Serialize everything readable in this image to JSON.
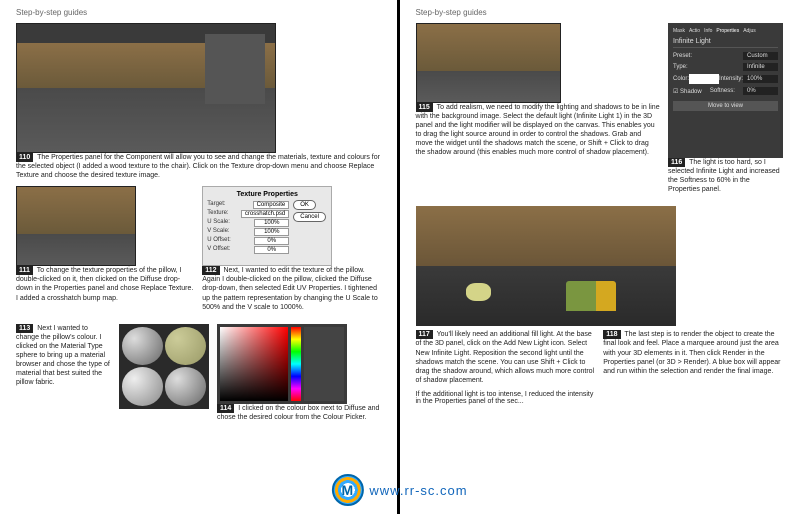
{
  "header": "Step-by-step guides",
  "steps": {
    "s10": {
      "num": "110",
      "text": "The Properties panel for the Component will allow you to see and change the materials, texture and colours for the selected object (I added a wood texture to the chair). Click on the Texture drop-down menu and choose Replace Texture and choose the desired texture image."
    },
    "s11": {
      "num": "111",
      "text": "To change the texture properties of the pillow, I double-clicked on it, then clicked on the Diffuse drop-down in the Properties panel and chose Replace Texture. I added a crosshatch bump map."
    },
    "s12": {
      "num": "112",
      "text": "Next, I wanted to edit the texture of the pillow. Again I double-clicked on the pillow, clicked the Diffuse drop-down, then selected Edit UV Properties. I tightened up the pattern representation by changing the U Scale to 500% and the V scale to 1000%."
    },
    "s13": {
      "num": "113",
      "text": "Next I wanted to change the pillow's colour. I clicked on the Material Type sphere to bring up a material browser and chose the type of material that best suited the pillow fabric."
    },
    "s14": {
      "num": "114",
      "text": "I clicked on the colour box next to Diffuse and chose the desired colour from the Colour Picker."
    },
    "s15": {
      "num": "115",
      "text": "To add realism, we need to modify the lighting and shadows to be in line with the background image. Select the default light (Infinite Light 1) in the 3D panel and the light modifier will be displayed on the canvas. This enables you to drag the light source around in order to control the shadows. Grab and move the widget until the shadows match the scene, or Shift + Click to drag the shadow around (this enables much more control of shadow placement)."
    },
    "s16": {
      "num": "116",
      "text": "The light is too hard, so I selected Infinite Light and increased the Softness to 60% in the Properties panel."
    },
    "s17": {
      "num": "117",
      "text": "You'll likely need an additional fill light. At the base of the 3D panel, click on the Add New Light icon. Select New Infinite Light. Reposition the second light until the shadows match the scene. You can use Shift + Click to drag the shadow around, which allows much more control of shadow placement."
    },
    "s18": {
      "num": "118",
      "text": "The last step is to render the object to create the final look and feel. Place a marquee around just the area with your 3D elements in it. Then click Render in the Properties panel (or 3D > Render). A blue box will appear and run within the selection and render the final image."
    },
    "cutL": "If the additional light is too intense, I reduced the intensity in the Properties panel of the sec..."
  },
  "texPanel": {
    "title": "Texture Properties",
    "target": "Target:",
    "targetVal": "Composite",
    "texture": "Texture:",
    "textureVal": "crosshatch.psd",
    "uscale": "U Scale:",
    "uscaleVal": "100%",
    "vscale": "V Scale:",
    "vscaleVal": "100%",
    "uoffset": "U Offset:",
    "uoffsetVal": "0%",
    "voffset": "V Offset:",
    "voffsetVal": "0%",
    "ok": "OK",
    "cancel": "Cancel"
  },
  "propsPanel": {
    "tabs": {
      "t1": "Mask",
      "t2": "Actio",
      "t3": "Info",
      "t4": "Properties",
      "t5": "Adjus"
    },
    "title": "Infinite Light",
    "preset": "Preset:",
    "presetVal": "Custom",
    "type": "Type:",
    "typeVal": "Infinite",
    "color": "Color:",
    "intensity": "Intensity:",
    "intensityVal": "100%",
    "shadow": "Shadow",
    "softness": "Softness:",
    "softnessVal": "0%",
    "moveView": "Move to view"
  },
  "watermark": {
    "badge": "M",
    "url": "www.rr-sc.com"
  }
}
